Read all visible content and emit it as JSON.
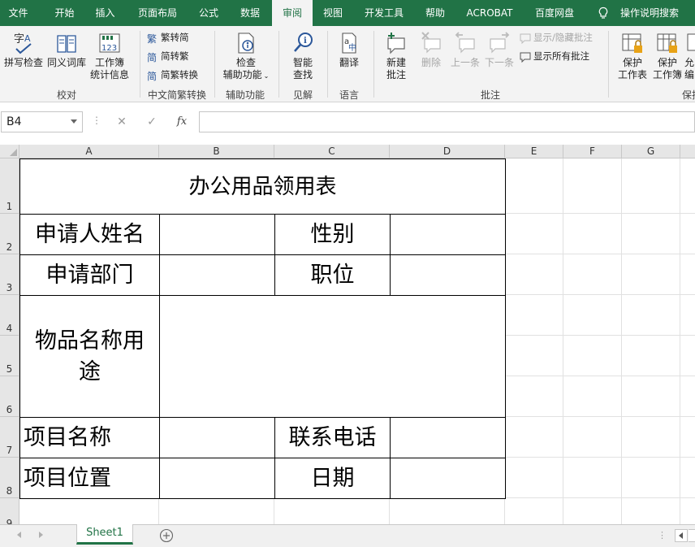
{
  "menu": {
    "tabs": [
      "文件",
      "开始",
      "插入",
      "页面布局",
      "公式",
      "数据",
      "审阅",
      "视图",
      "开发工具",
      "帮助",
      "ACROBAT",
      "百度网盘"
    ],
    "active_tab": "审阅",
    "tell_me": "操作说明搜索",
    "accent_color": "#217346"
  },
  "ribbon": {
    "proofing": {
      "spell_check": "拼写检查",
      "thesaurus": "同义词库",
      "workbook_stats": [
        "工作簿",
        "统计信息"
      ],
      "label": "校对"
    },
    "chinese_conversion": {
      "to_simplified": "繁转简",
      "to_traditional": "简转繁",
      "convert": "简繁转换",
      "label": "中文简繁转换"
    },
    "accessibility": {
      "check": [
        "检查",
        "辅助功能"
      ],
      "label": "辅助功能"
    },
    "insights": {
      "smart_lookup": [
        "智能",
        "查找"
      ],
      "label": "见解"
    },
    "language": {
      "translate": "翻译",
      "label": "语言"
    },
    "comments": {
      "new_comment": [
        "新建",
        "批注"
      ],
      "delete": "删除",
      "previous": "上一条",
      "next": "下一条",
      "show_hide": "显示/隐藏批注",
      "show_all": "显示所有批注",
      "label": "批注"
    },
    "protect": {
      "protect_sheet": [
        "保护",
        "工作表"
      ],
      "protect_workbook": [
        "保护",
        "工作簿"
      ],
      "allow_edit": [
        "允",
        "编"
      ],
      "label": "保护"
    }
  },
  "formula_bar": {
    "name_box": "B4",
    "fx_label": "fx",
    "cancel_symbol": "✕",
    "enter_symbol": "✓",
    "value": ""
  },
  "grid": {
    "columns": [
      "A",
      "B",
      "C",
      "D",
      "E",
      "F",
      "G"
    ],
    "rows": [
      "1",
      "2",
      "3",
      "4",
      "5",
      "6",
      "7",
      "8",
      "9"
    ],
    "cells": {
      "title": "办公用品领用表",
      "applicant_name": "申请人姓名",
      "gender": "性别",
      "department": "申请部门",
      "position": "职位",
      "item_purpose_line1": "物品名称用",
      "item_purpose_line2": "途",
      "project_name": "项目名称",
      "phone": "联系电话",
      "project_location": "项目位置",
      "date": "日期"
    }
  },
  "sheets": {
    "tabs": [
      "Sheet1"
    ],
    "active": "Sheet1"
  }
}
